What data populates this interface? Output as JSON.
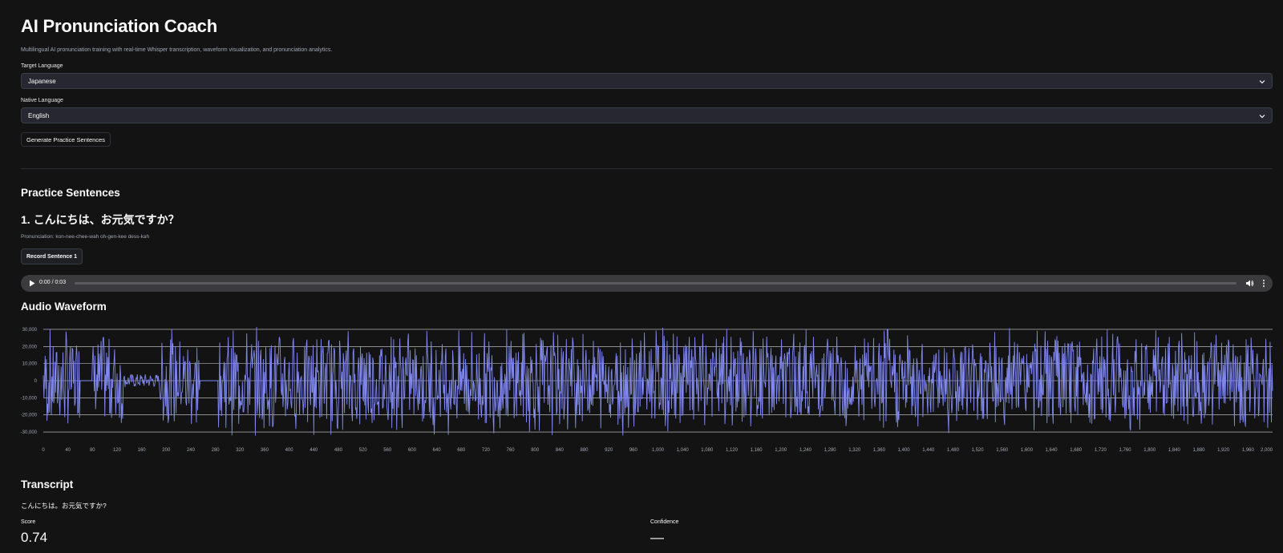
{
  "app": {
    "title": "AI Pronunciation Coach",
    "subtitle": "Multilingual AI pronunciation training with real-time Whisper transcription, waveform visualization, and pronunciation analytics."
  },
  "form": {
    "target_language": {
      "label": "Target Language",
      "value": "Japanese"
    },
    "native_language": {
      "label": "Native Language",
      "value": "English"
    },
    "generate_button": "Generate Practice Sentences"
  },
  "practice": {
    "heading": "Practice Sentences",
    "sentence_title": "1. こんにちは、お元気ですか？",
    "pronunciation": "Pronunciation: kon-nee-chee-wah oh-gen-kee dess-kah",
    "record_button": "Record Sentence 1"
  },
  "audio": {
    "time": "0:00 / 0:03",
    "progress": 0
  },
  "waveform": {
    "heading": "Audio Waveform"
  },
  "transcript": {
    "heading": "Transcript",
    "text": "こんにちは。お元気ですか?"
  },
  "metrics": {
    "score_label": "Score",
    "score_value": "0.74",
    "confidence_label": "Confidence",
    "confidence_value": "—"
  },
  "chart_data": {
    "type": "line",
    "ylim": [
      -32768,
      32767
    ],
    "xlim": [
      0,
      2000
    ],
    "y_ticks": [
      30000,
      20000,
      10000,
      0,
      -10000,
      -20000,
      -30000
    ],
    "y_tick_labels": [
      "30,000",
      "20,000",
      "10,000",
      "0",
      "-10,000",
      "-20,000",
      "-30,000"
    ],
    "x_ticks": [
      0,
      40,
      80,
      120,
      160,
      200,
      240,
      280,
      320,
      360,
      400,
      440,
      480,
      520,
      560,
      600,
      640,
      680,
      720,
      760,
      800,
      840,
      880,
      920,
      960,
      1000,
      1040,
      1080,
      1120,
      1160,
      1200,
      1240,
      1280,
      1320,
      1360,
      1400,
      1440,
      1480,
      1520,
      1560,
      1600,
      1640,
      1680,
      1720,
      1760,
      1800,
      1840,
      1880,
      1920,
      1960,
      2000
    ],
    "x_tick_labels": [
      "0",
      "40",
      "80",
      "120",
      "160",
      "200",
      "240",
      "280",
      "320",
      "360",
      "400",
      "440",
      "480",
      "520",
      "560",
      "600",
      "640",
      "680",
      "720",
      "760",
      "800",
      "840",
      "880",
      "920",
      "960",
      "1,000",
      "1,040",
      "1,080",
      "1,120",
      "1,160",
      "1,200",
      "1,240",
      "1,280",
      "1,320",
      "1,360",
      "1,400",
      "1,440",
      "1,480",
      "1,520",
      "1,560",
      "1,600",
      "1,640",
      "1,680",
      "1,720",
      "1,760",
      "1,800",
      "1,840",
      "1,880",
      "1,920",
      "1,960",
      "2,000"
    ],
    "grid": true,
    "series": [
      {
        "color": "#8088f0"
      }
    ]
  }
}
